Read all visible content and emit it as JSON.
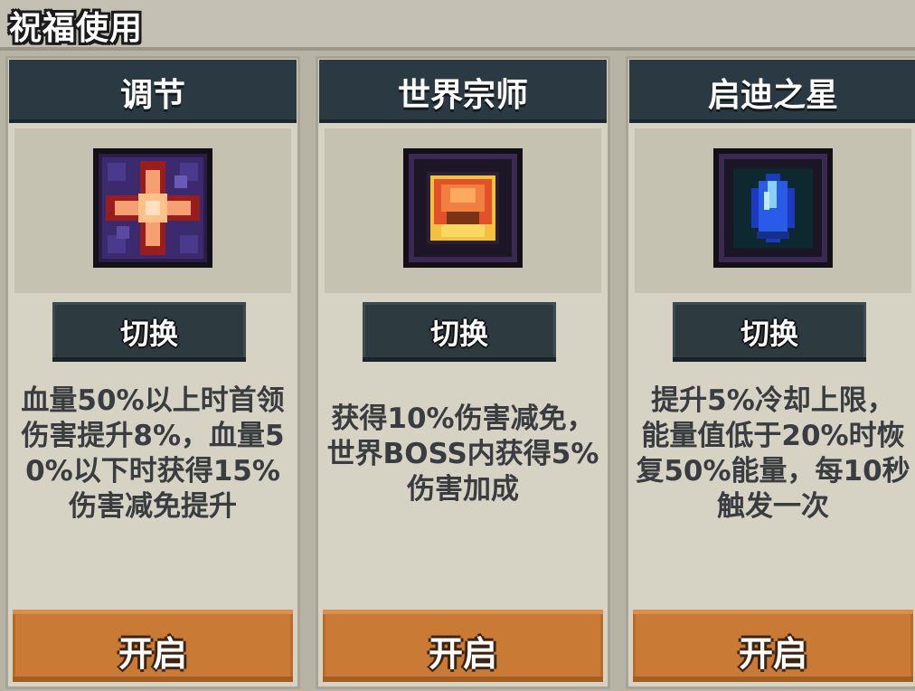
{
  "header": {
    "title": "祝福使用"
  },
  "cards": [
    {
      "title": "调节",
      "icon": "cross-star-icon",
      "switch_label": "切换",
      "description": "血量50%以上时首领\n伤害提升8%，血量5\n0%以下时获得15%\n伤害减免提升",
      "open_label": "开启"
    },
    {
      "title": "世界宗师",
      "icon": "flame-shield-icon",
      "switch_label": "切换",
      "description": "获得10%伤害减免，\n世界BOSS内获得5%\n伤害加成",
      "open_label": "开启"
    },
    {
      "title": "启迪之星",
      "icon": "blue-crystal-icon",
      "switch_label": "切换",
      "description": "提升5%冷却上限，\n能量值低于20%时恢\n复50%能量，每10秒\n触发一次",
      "open_label": "开启"
    }
  ]
}
